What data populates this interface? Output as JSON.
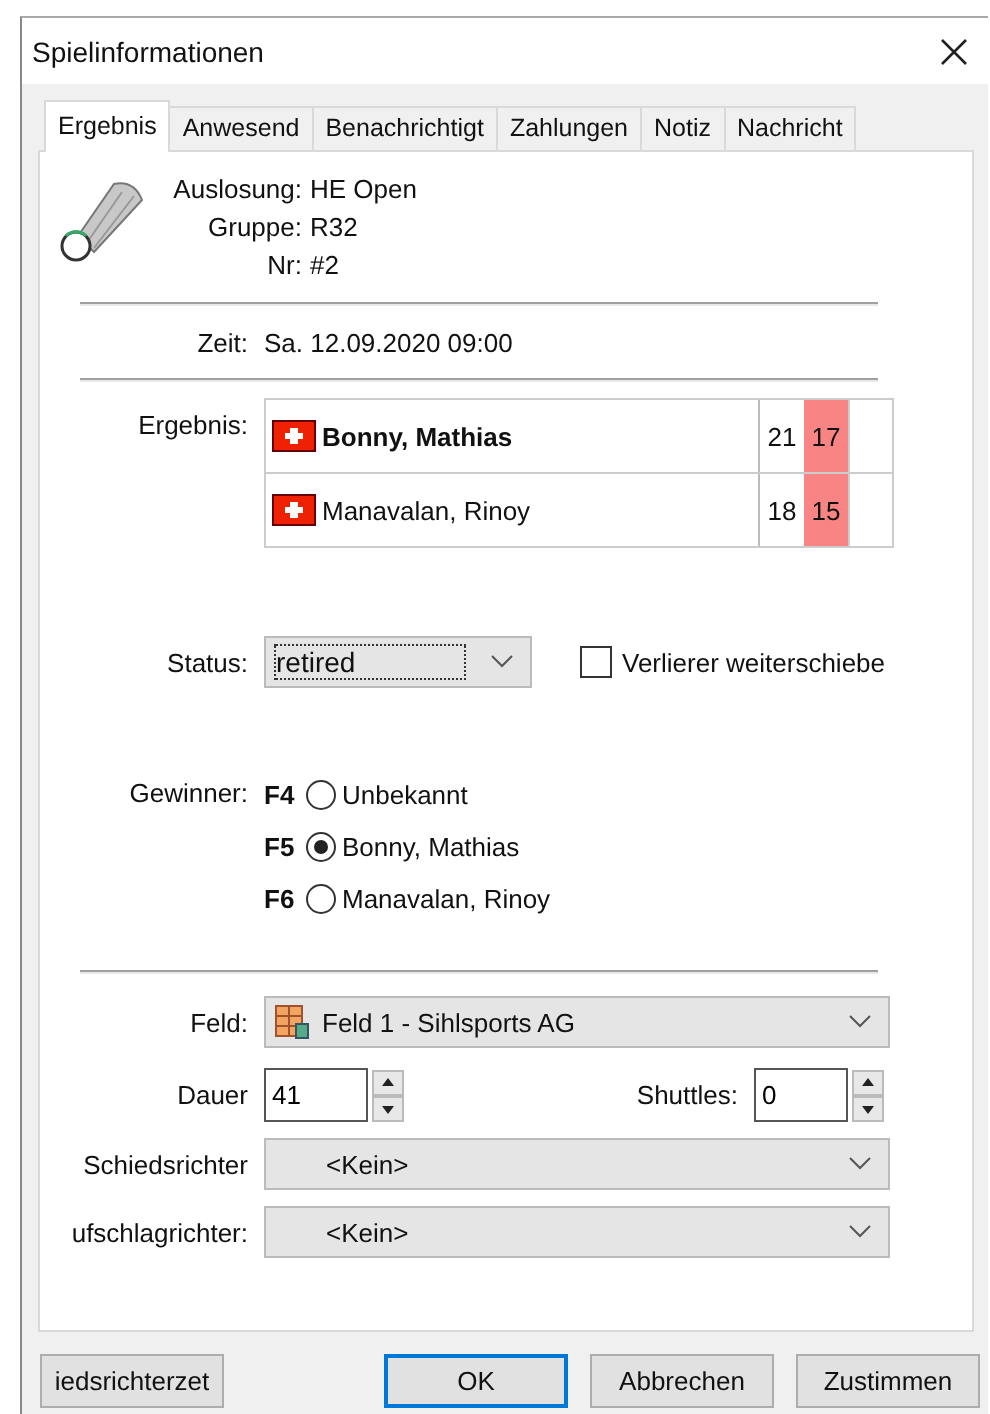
{
  "window": {
    "title": "Spielinformationen"
  },
  "tabs": [
    {
      "label": "Ergebnis",
      "selected": true
    },
    {
      "label": "Anwesend",
      "selected": false
    },
    {
      "label": "Benachrichtigt",
      "selected": false
    },
    {
      "label": "Zahlungen",
      "selected": false
    },
    {
      "label": "Notiz",
      "selected": false
    },
    {
      "label": "Nachricht",
      "selected": false
    }
  ],
  "match_info": [
    {
      "label": "Auslosung:",
      "value": "HE Open"
    },
    {
      "label": "Gruppe:",
      "value": "R32"
    },
    {
      "label": "Nr:",
      "value": "#2"
    }
  ],
  "time": {
    "label": "Zeit:",
    "value": "Sa. 12.09.2020 09:00"
  },
  "result": {
    "label": "Ergebnis:",
    "players": [
      {
        "name": "Bonny, Mathias",
        "winner": true,
        "scores": [
          {
            "value": "21",
            "highlighted": false
          },
          {
            "value": "17",
            "highlighted": true
          }
        ]
      },
      {
        "name": "Manavalan, Rinoy",
        "winner": false,
        "scores": [
          {
            "value": "18",
            "highlighted": false
          },
          {
            "value": "15",
            "highlighted": true
          }
        ]
      }
    ]
  },
  "status": {
    "label": "Status:",
    "value": "retired"
  },
  "move_loser": {
    "label": "Verlierer weiterschiebe",
    "checked": false
  },
  "winner": {
    "label": "Gewinner:",
    "options": [
      {
        "key": "F4",
        "label": "Unbekannt",
        "selected": false
      },
      {
        "key": "F5",
        "label": "Bonny, Mathias",
        "selected": true
      },
      {
        "key": "F6",
        "label": "Manavalan, Rinoy",
        "selected": false
      }
    ]
  },
  "court": {
    "label": "Feld:",
    "value": "Feld 1 - Sihlsports AG"
  },
  "duration": {
    "label": "Dauer",
    "value": "41"
  },
  "shuttles": {
    "label": "Shuttles:",
    "value": "0"
  },
  "umpire": {
    "label": "Schiedsrichter",
    "value": "<Kein>"
  },
  "service_judge": {
    "label": "ufschlagrichter:",
    "value": "<Kein>"
  },
  "buttons": [
    {
      "label": "iedsrichterzet",
      "default": false
    },
    {
      "label": "OK",
      "default": true
    },
    {
      "label": "Abbrechen",
      "default": false
    },
    {
      "label": "Zustimmen",
      "default": false
    }
  ]
}
